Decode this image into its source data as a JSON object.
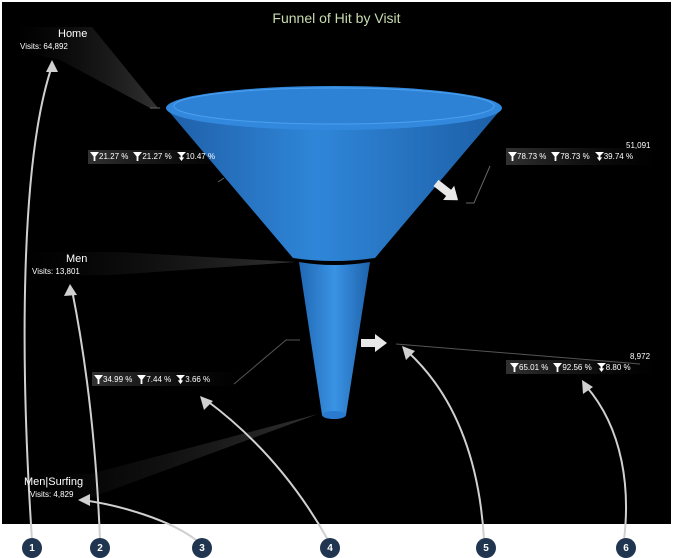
{
  "title": "Funnel of Hit by Visit",
  "colors": {
    "background": "#000000",
    "funnel": "#2a7fd4",
    "title": "#c8dcb0",
    "callout": "#20354f"
  },
  "stages": [
    {
      "name": "Home",
      "visits": "Visits: 64,892"
    },
    {
      "name": "Men",
      "visits": "Visits: 13,801"
    },
    {
      "name": "Men|Surfing",
      "visits": "Visits: 4,829"
    }
  ],
  "continue_rates": [
    {
      "values": [
        "21.27 %",
        "21.27 %",
        "10.47 %"
      ]
    },
    {
      "values": [
        "34.99 %",
        "7.44 %",
        "3.66 %"
      ]
    }
  ],
  "exit_rates": [
    {
      "count": "51,091",
      "values": [
        "78.73 %",
        "78.73 %",
        "39.74 %"
      ]
    },
    {
      "count": "8,972",
      "values": [
        "65.01 %",
        "92.56 %",
        "8.80 %"
      ]
    }
  ],
  "callouts": [
    "1",
    "2",
    "3",
    "4",
    "5",
    "6"
  ],
  "icons": [
    "funnel-icon",
    "funnel-down-icon",
    "down-arrow-icon",
    "exit-arrow-icon"
  ]
}
